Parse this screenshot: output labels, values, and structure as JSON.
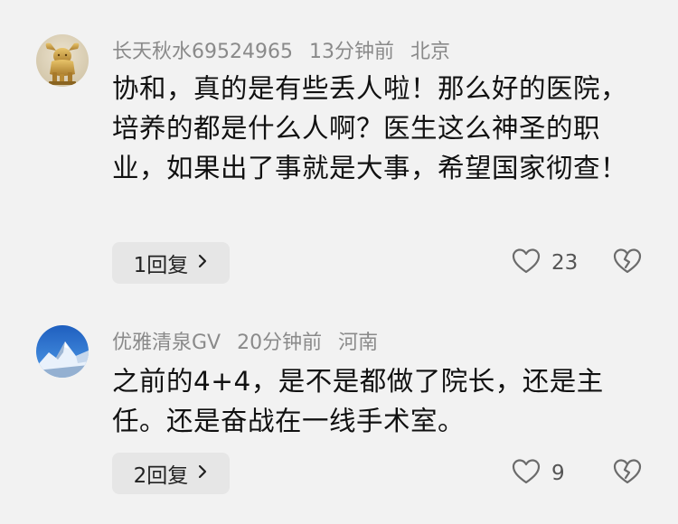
{
  "comments": [
    {
      "username": "长天秋水69524965",
      "time": "13分钟前",
      "location": "北京",
      "text": "协和，真的是有些丢人啦！那么好的医院，培养的都是什么人啊？医生这么神圣的职业，如果出了事就是大事，希望国家彻查！",
      "reply_label": "1回复",
      "like_count": "23",
      "avatar_icon": "golden-bull-icon"
    },
    {
      "username": "优雅清泉GV",
      "time": "20分钟前",
      "location": "河南",
      "text": "之前的4+4，是不是都做了院长，还是主任。还是奋战在一线手术室。",
      "reply_label": "2回复",
      "like_count": "9",
      "avatar_icon": "snow-mountain-icon"
    }
  ],
  "icons": {
    "like": "heart-outline-icon",
    "dislike": "broken-heart-icon",
    "chevron": "chevron-right-icon"
  },
  "colors": {
    "background": "#f2f2f2",
    "meta_text": "#8a8a8a",
    "reply_button_bg": "#e6e6e6"
  }
}
